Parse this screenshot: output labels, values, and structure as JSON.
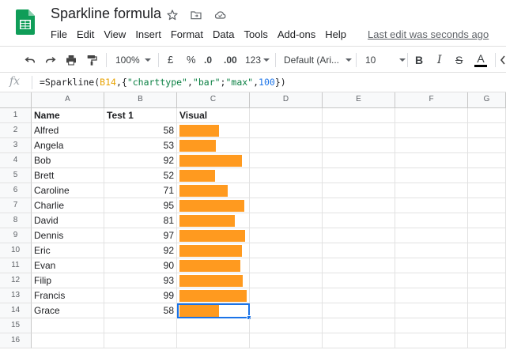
{
  "document": {
    "title": "Sparkline formula"
  },
  "menu": [
    "File",
    "Edit",
    "View",
    "Insert",
    "Format",
    "Data",
    "Tools",
    "Add-ons",
    "Help"
  ],
  "last_edit": "Last edit was seconds ago",
  "toolbar": {
    "zoom": "100%",
    "currency": "£",
    "percent": "%",
    "decrease_decimal": ".0",
    "increase_decimal": ".00",
    "more_formats": "123",
    "font": "Default (Ari...",
    "font_size": "10",
    "bold": "B",
    "italic": "I",
    "strikethrough": "S",
    "text_color": "A"
  },
  "formula_bar": {
    "fx_label": "fx",
    "parts": {
      "p1": "=Sparkline(",
      "p2": "B14",
      "p3": ",{",
      "p4": "\"charttype\"",
      "p5": ",",
      "p6": "\"bar\"",
      "p7": ";",
      "p8": "\"max\"",
      "p9": ",",
      "p10": "100",
      "p11": "})"
    }
  },
  "grid": {
    "columns": [
      "A",
      "B",
      "C",
      "D",
      "E",
      "F",
      "G"
    ],
    "rows": [
      "1",
      "2",
      "3",
      "4",
      "5",
      "6",
      "7",
      "8",
      "9",
      "10",
      "11",
      "12",
      "13",
      "14",
      "15",
      "16"
    ],
    "headers": {
      "name": "Name",
      "test": "Test 1",
      "visual": "Visual"
    },
    "records": [
      {
        "name": "Alfred",
        "score": "58"
      },
      {
        "name": "Angela",
        "score": "53"
      },
      {
        "name": "Bob",
        "score": "92"
      },
      {
        "name": "Brett",
        "score": "52"
      },
      {
        "name": "Caroline",
        "score": "71"
      },
      {
        "name": "Charlie",
        "score": "95"
      },
      {
        "name": "David",
        "score": "81"
      },
      {
        "name": "Dennis",
        "score": "97"
      },
      {
        "name": "Eric",
        "score": "92"
      },
      {
        "name": "Evan",
        "score": "90"
      },
      {
        "name": "Filip",
        "score": "93"
      },
      {
        "name": "Francis",
        "score": "99"
      },
      {
        "name": "Grace",
        "score": "58"
      }
    ],
    "sparkline_max": 100,
    "bar_color": "#ff9a1f",
    "selected_cell": "C14"
  }
}
